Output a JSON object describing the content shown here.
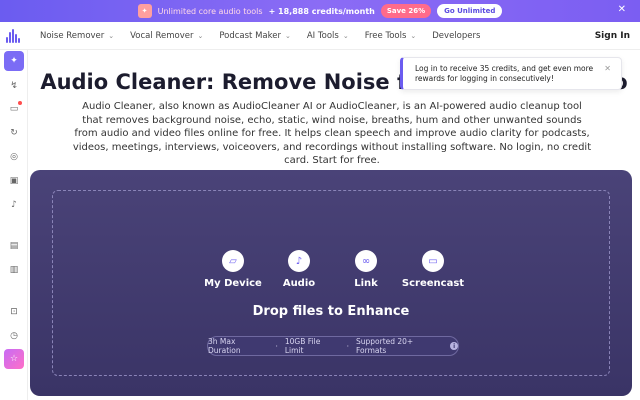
{
  "promo": {
    "text": "Unlimited core audio tools",
    "credits": "+ 18,888 credits/month",
    "save_label": "Save 26%",
    "cta_label": "Go Unlimited"
  },
  "nav": {
    "items": [
      {
        "label": "Noise Remover",
        "dropdown": true
      },
      {
        "label": "Vocal Remover",
        "dropdown": true
      },
      {
        "label": "Podcast Maker",
        "dropdown": true
      },
      {
        "label": "AI Tools",
        "dropdown": true
      },
      {
        "label": "Free Tools",
        "dropdown": true
      },
      {
        "label": "Developers",
        "dropdown": false
      }
    ],
    "signin": "Sign In"
  },
  "tooltip": {
    "text": "Log in to receive 35 credits, and get even more rewards for logging in consecutively!"
  },
  "hero": {
    "title": "Audio Cleaner: Remove Noise from Audio & Video",
    "description": "Audio Cleaner, also known as AudioCleaner AI or AudioCleaner, is an AI-powered audio cleanup tool that removes background noise, echo, static, wind noise, breaths, hum and other unwanted sounds from audio and video files online for free. It helps clean speech and improve audio clarity for podcasts, videos, meetings, interviews, voiceovers, and recordings without installing software. No login, no credit card. Start for free."
  },
  "upload": {
    "sources": [
      {
        "label": "My Device",
        "icon": "folder-icon"
      },
      {
        "label": "Audio",
        "icon": "microphone-icon"
      },
      {
        "label": "Link",
        "icon": "link-icon"
      },
      {
        "label": "Screencast",
        "icon": "screen-icon"
      }
    ],
    "drop_title": "Drop files to Enhance",
    "limits": [
      "3h Max Duration",
      "10GB File Limit",
      "Supported 20+ Formats"
    ]
  },
  "colors": {
    "accent": "#6b5cf0",
    "dropzone": "#4a4378"
  }
}
